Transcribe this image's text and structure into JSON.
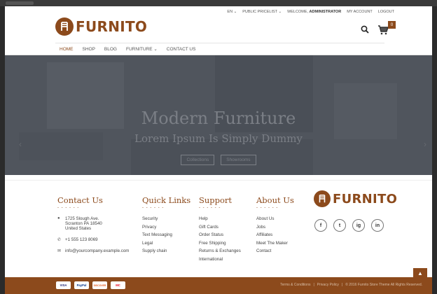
{
  "header": {
    "top_links": {
      "lang": "EN ⌄",
      "pricelist": "PUBLIC PRICELIST ⌄",
      "welcome": "WELCOME,",
      "user": "ADMINISTRATOR",
      "account": "MY ACCOUNT",
      "logout": "LOGOUT"
    },
    "brand": "FURNITO",
    "cart_count": "0",
    "nav": [
      "HOME",
      "SHOP",
      "BLOG",
      "FURNITURE ⌄",
      "CONTACT US"
    ]
  },
  "hero": {
    "title": "Modern Furniture",
    "subtitle": "Lorem Ipsum Is Simply Dummy",
    "buttons": [
      "Collections",
      "Showrooms"
    ]
  },
  "footer": {
    "contact": {
      "heading": "Contact Us",
      "address_lines": [
        "1725 Slough Ave.",
        "Scranton PA 18540",
        "United States"
      ],
      "phone": "+1 555 123 8069",
      "email": "info@yourcompany.example.com"
    },
    "quick_links": {
      "heading": "Quick Links",
      "items": [
        "Security",
        "Privacy",
        "Text Messaging",
        "Legal",
        "Supply chain"
      ]
    },
    "support": {
      "heading": "Support",
      "items": [
        "Help",
        "Gift Cards",
        "Order Status",
        "Free Shipping",
        "Returns & Exchanges",
        "International"
      ]
    },
    "about": {
      "heading": "About Us",
      "items": [
        "About Us",
        "Jobs",
        "Affiliates",
        "Meet The Maker",
        "Contact"
      ]
    },
    "brand": "FURNITO",
    "socials": [
      "f",
      "t",
      "ig",
      "in"
    ],
    "dashes": "- - - - - -"
  },
  "bottom": {
    "cards": [
      "VISA",
      "PayPal",
      "DISCOVER",
      "MC"
    ],
    "terms": "Terms & Conditions",
    "sep": "|",
    "privacy": "Privacy Policy",
    "copyright": "© 2016 Furnito Store Theme All Rights Reserved."
  },
  "colors": {
    "brand": "#8c4a1c",
    "hero_overlay": "#50555d"
  }
}
